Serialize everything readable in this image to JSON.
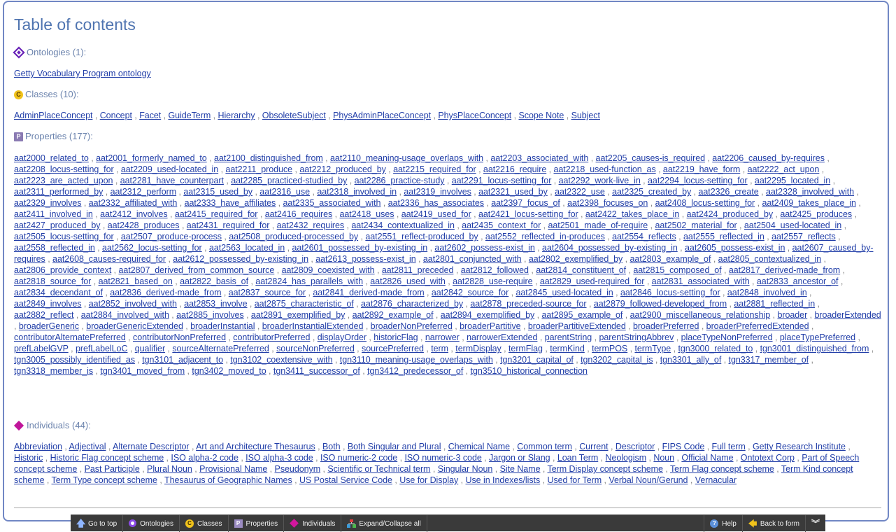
{
  "title": "Table of contents",
  "ontologies": {
    "heading": "Ontologies (1):",
    "items": [
      "Getty Vocabulary Program ontology"
    ]
  },
  "classes": {
    "heading": "Classes (10):",
    "items": [
      "AdminPlaceConcept",
      "Concept",
      "Facet",
      "GuideTerm",
      "Hierarchy",
      "ObsoleteSubject",
      "PhysAdminPlaceConcept",
      "PhysPlaceConcept",
      "Scope Note",
      "Subject"
    ]
  },
  "properties": {
    "heading": "Properties (177):",
    "items": [
      "aat2000_related_to",
      "aat2001_formerly_named_to",
      "aat2100_distinguished_from",
      "aat2110_meaning-usage_overlaps_with",
      "aat2203_associated_with",
      "aat2205_causes-is_required",
      "aat2206_caused_by-requires",
      "aat2208_locus-setting_for",
      "aat2209_used-located_in",
      "aat2211_produce",
      "aat2212_produced_by",
      "aat2215_required_for",
      "aat2216_require",
      "aat2218_used-function_as",
      "aat2219_have_form",
      "aat2222_act_upon",
      "aat2223_are_acted_upon",
      "aat2281_have_counterpart",
      "aat2285_practiced-studied_by",
      "aat2286_practice-study",
      "aat2291_locus-setting_for",
      "aat2292_work-live_in",
      "aat2294_locus-setting_for",
      "aat2295_located_in",
      "aat2311_performed_by",
      "aat2312_perform",
      "aat2315_used_by",
      "aat2316_use",
      "aat2318_involved_in",
      "aat2319_involves",
      "aat2321_used_by",
      "aat2322_use",
      "aat2325_created_by",
      "aat2326_create",
      "aat2328_involved_with",
      "aat2329_involves",
      "aat2332_affiliated_with",
      "aat2333_have_affiliates",
      "aat2335_associated_with",
      "aat2336_has_associates",
      "aat2397_focus_of",
      "aat2398_focuses_on",
      "aat2408_locus-setting_for",
      "aat2409_takes_place_in",
      "aat2411_involved_in",
      "aat2412_involves",
      "aat2415_required_for",
      "aat2416_requires",
      "aat2418_uses",
      "aat2419_used_for",
      "aat2421_locus-setting_for",
      "aat2422_takes_place_in",
      "aat2424_produced_by",
      "aat2425_produces",
      "aat2427_produced_by",
      "aat2428_produces",
      "aat2431_required_for",
      "aat2432_requires",
      "aat2434_contextualized_in",
      "aat2435_context_for",
      "aat2501_made_of-require",
      "aat2502_material_for",
      "aat2504_used-located_in",
      "aat2505_locus-setting_for",
      "aat2507_produce-process",
      "aat2508_produced-processed_by",
      "aat2551_reflect-produced_by",
      "aat2552_reflected_in-produces",
      "aat2554_reflects",
      "aat2555_reflected_in",
      "aat2557_reflects",
      "aat2558_reflected_in",
      "aat2562_locus-setting_for",
      "aat2563_located_in",
      "aat2601_possessed_by-existing_in",
      "aat2602_possess-exist_in",
      "aat2604_possessed_by-existing_in",
      "aat2605_possess-exist_in",
      "aat2607_caused_by-requires",
      "aat2608_causes-required_for",
      "aat2612_possessed_by-existing_in",
      "aat2613_possess-exist_in",
      "aat2801_conjuncted_with",
      "aat2802_exemplified_by",
      "aat2803_example_of",
      "aat2805_contextualized_in",
      "aat2806_provide_context",
      "aat2807_derived_from_common_source",
      "aat2809_coexisted_with",
      "aat2811_preceded",
      "aat2812_followed",
      "aat2814_constituent_of",
      "aat2815_composed_of",
      "aat2817_derived-made_from",
      "aat2818_source_for",
      "aat2821_based_on",
      "aat2822_basis_of",
      "aat2824_has_parallels_with",
      "aat2826_used_with",
      "aat2828_use-require",
      "aat2829_used-required_for",
      "aat2831_associated_with",
      "aat2833_ancestor_of",
      "aat2834_decendant_of",
      "aat2836_derived-made_from",
      "aat2837_source_for",
      "aat2841_derived-made_from",
      "aat2842_source_for",
      "aat2845_used-located_in",
      "aat2846_locus-setting_for",
      "aat2848_involved_in",
      "aat2849_involves",
      "aat2852_involved_with",
      "aat2853_involve",
      "aat2875_characteristic_of",
      "aat2876_characterized_by",
      "aat2878_preceded-source_for",
      "aat2879_followed-developed_from",
      "aat2881_reflected_in",
      "aat2882_reflect",
      "aat2884_involved_with",
      "aat2885_involves",
      "aat2891_exemplified_by",
      "aat2892_example_of",
      "aat2894_exemplified_by",
      "aat2895_example_of",
      "aat2900_miscellaneous_relationship",
      "broader",
      "broaderExtended",
      "broaderGeneric",
      "broaderGenericExtended",
      "broaderInstantial",
      "broaderInstantialExtended",
      "broaderNonPreferred",
      "broaderPartitive",
      "broaderPartitiveExtended",
      "broaderPreferred",
      "broaderPreferredExtended",
      "contributorAlternatePreferred",
      "contributorNonPreferred",
      "contributorPreferred",
      "displayOrder",
      "historicFlag",
      "narrower",
      "narrowerExtended",
      "parentString",
      "parentStringAbbrev",
      "placeTypeNonPreferred",
      "placeTypePreferred",
      "prefLabelGVP",
      "prefLabelLoC",
      "qualifier",
      "sourceAlternatePreferred",
      "sourceNonPreferred",
      "sourcePreferred",
      "term",
      "termDisplay",
      "termFlag",
      "termKind",
      "termPOS",
      "termType",
      "tgn3000_related_to",
      "tgn3001_distinguished_from",
      "tgn3005_possibly_identified_as",
      "tgn3101_adjacent_to",
      "tgn3102_coextensive_with",
      "tgn3110_meaning-usage_overlaps_with",
      "tgn3201_capital_of",
      "tgn3202_capital_is",
      "tgn3301_ally_of",
      "tgn3317_member_of",
      "tgn3318_member_is",
      "tgn3401_moved_from",
      "tgn3402_moved_to",
      "tgn3411_successor_of",
      "tgn3412_predecessor_of",
      "tgn3510_historical_connection"
    ]
  },
  "individuals": {
    "heading": "Individuals (44):",
    "items": [
      "Abbreviation",
      "Adjectival",
      "Alternate Descriptor",
      "Art and Architecture Thesaurus",
      "Both",
      "Both Singular and Plural",
      "Chemical Name",
      "Common term",
      "Current",
      "Descriptor",
      "FIPS Code",
      "Full term",
      "Getty Research Institute",
      "Historic",
      "Historic Flag concept scheme",
      "ISO alpha-2 code",
      "ISO alpha-3 code",
      "ISO numeric-2 code",
      "ISO numeric-3 code",
      "Jargon or Slang",
      "Loan Term",
      "Neologism",
      "Noun",
      "Official Name",
      "Ontotext Corp",
      "Part of Speech concept scheme",
      "Past Participle",
      "Plural Noun",
      "Provisional Name",
      "Pseudonym",
      "Scientific or Technical term",
      "Singular Noun",
      "Site Name",
      "Term Display concept scheme",
      "Term Flag concept scheme",
      "Term Kind concept scheme",
      "Term Type concept scheme",
      "Thesaurus of Geographic Names",
      "US Postal Service Code",
      "Use for Display",
      "Use in Indexes/lists",
      "Used for Term",
      "Verbal Noun/Gerund",
      "Vernacular"
    ]
  },
  "toolbar": {
    "go_to_top": "Go to top",
    "ontologies": "Ontologies",
    "classes": "Classes",
    "properties": "Properties",
    "individuals": "Individuals",
    "expand_collapse": "Expand/Collapse all",
    "help": "Help",
    "back_to_form": "Back to form"
  },
  "icons": {
    "ontology": "ontology-diamond-icon",
    "class": "class-c-icon",
    "property": "property-p-icon",
    "individual": "individual-diamond-icon",
    "go_to_top": "arrow-up-icon",
    "expand_collapse": "expand-collapse-icon",
    "help": "help-icon",
    "back": "back-arrow-icon",
    "chevron": "double-chevron-down-icon"
  },
  "colors": {
    "link": "#213ea8",
    "title": "#4f74b0",
    "border": "#7187c4",
    "toolbar_bg": "#3a3a3a"
  }
}
